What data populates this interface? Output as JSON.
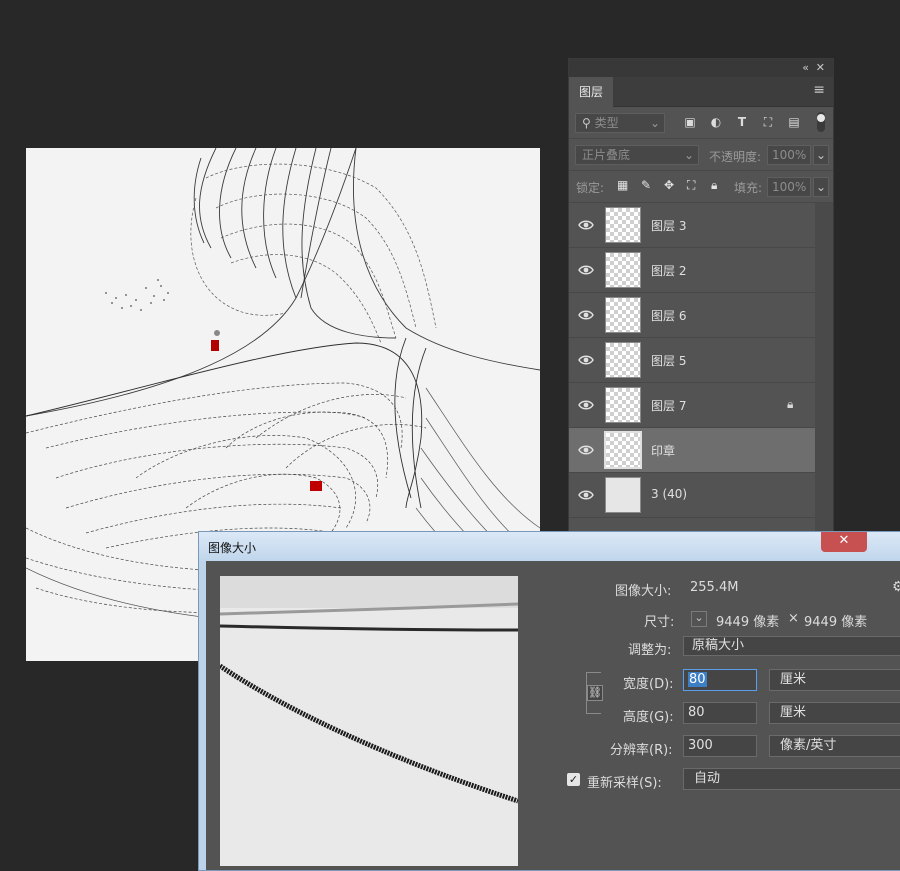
{
  "layers_panel": {
    "tab_label": "图层",
    "filter": {
      "label": "类型"
    },
    "blend_mode": "正片叠底",
    "opacity_label": "不透明度:",
    "opacity_value": "100%",
    "lock_label": "锁定:",
    "fill_label": "填充:",
    "fill_value": "100%",
    "layers": [
      {
        "name": "图层 3",
        "visible": true,
        "locked": false,
        "selected": false
      },
      {
        "name": "图层 2",
        "visible": true,
        "locked": false,
        "selected": false
      },
      {
        "name": "图层 6",
        "visible": true,
        "locked": false,
        "selected": false
      },
      {
        "name": "图层 5",
        "visible": true,
        "locked": false,
        "selected": false
      },
      {
        "name": "图层 7",
        "visible": true,
        "locked": true,
        "selected": false
      },
      {
        "name": "印章",
        "visible": true,
        "locked": false,
        "selected": true
      },
      {
        "name": "3 (40)",
        "visible": true,
        "locked": false,
        "selected": false
      }
    ]
  },
  "image_size_dialog": {
    "title": "图像大小",
    "image_size_label": "图像大小:",
    "image_size_value": "255.4M",
    "dimensions_label": "尺寸:",
    "dimensions_width": "9449 像素",
    "dimensions_times": "×",
    "dimensions_height": "9449 像素",
    "fit_to_label": "调整为:",
    "fit_to_value": "原稿大小",
    "width_label": "宽度(D):",
    "width_value": "80",
    "width_unit": "厘米",
    "height_label": "高度(G):",
    "height_value": "80",
    "height_unit": "厘米",
    "resolution_label": "分辨率(R):",
    "resolution_value": "300",
    "resolution_unit": "像素/英寸",
    "resample_label": "重新采样(S):",
    "resample_checked": true,
    "resample_value": "自动"
  },
  "colors": {
    "app_bg": "#282828",
    "panel_bg": "#535353",
    "selected_layer": "#6e6e6e",
    "seal_red": "#c00000",
    "focus_blue": "#3c7fc4"
  }
}
